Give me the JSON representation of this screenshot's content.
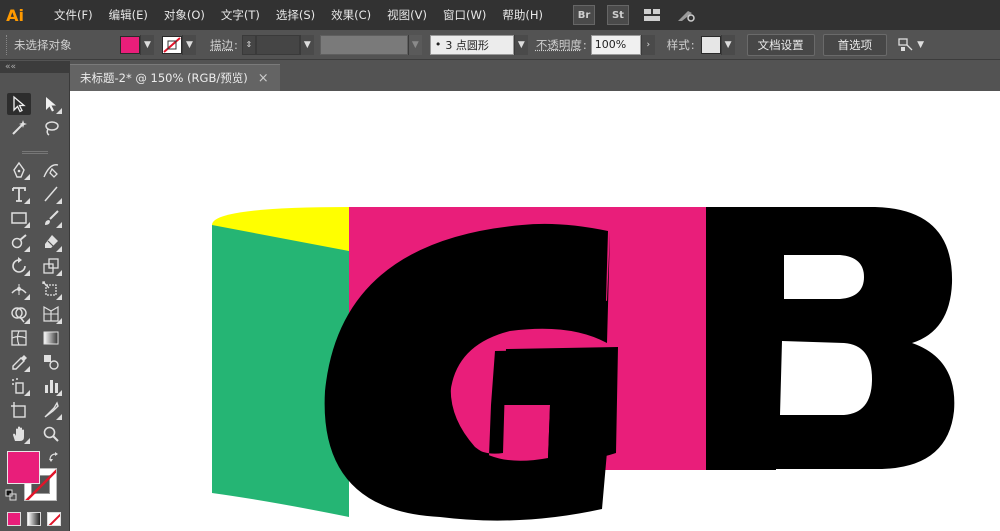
{
  "app": {
    "logo_text": "Ai",
    "logo_color": "#ff9a00"
  },
  "menu": {
    "items": [
      "文件(F)",
      "编辑(E)",
      "对象(O)",
      "文字(T)",
      "选择(S)",
      "效果(C)",
      "视图(V)",
      "窗口(W)",
      "帮助(H)"
    ],
    "app_icons": [
      "Br",
      "St"
    ]
  },
  "control_bar": {
    "selection_status": "未选择对象",
    "fill_color": "#e91e7a",
    "stroke_color": "none",
    "stroke_label": "描边",
    "stroke_weight_value": "",
    "brush_label": "3 点圆形",
    "opacity_label": "不透明度",
    "opacity_value": "100%",
    "style_label": "样式",
    "style_color": "#e6e6e6",
    "doc_setup_button": "文档设置",
    "preferences_button": "首选项"
  },
  "tab": {
    "title": "未标题-2* @ 150% (RGB/预览)",
    "close_glyph": "×"
  },
  "toolbar": {
    "collapse_glyph": "««",
    "fill_color": "#e91e7a",
    "stroke_color": "none"
  },
  "artwork": {
    "letters": [
      "G",
      "B"
    ],
    "colors": {
      "green": "#25b574",
      "yellow": "#ffff00",
      "magenta": "#e91e7a",
      "black": "#000000"
    }
  }
}
